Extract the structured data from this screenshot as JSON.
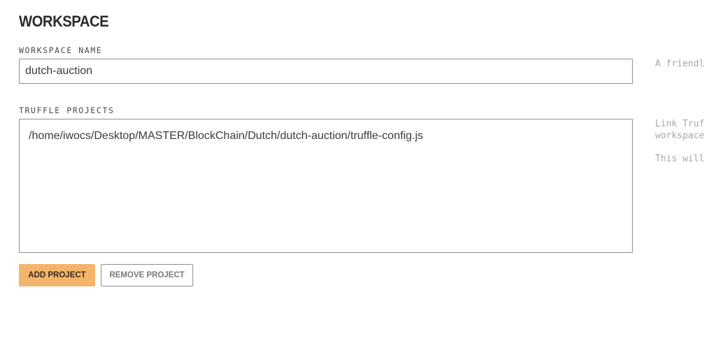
{
  "workspace": {
    "title": "WORKSPACE",
    "name_label": "WORKSPACE NAME",
    "name_value": "dutch-auction",
    "name_help": "A friendl",
    "projects_label": "TRUFFLE PROJECTS",
    "projects": [
      "/home/iwocs/Desktop/MASTER/BlockChain/Dutch/dutch-auction/truffle-config.js"
    ],
    "projects_help_line1": "Link Truf",
    "projects_help_line2": "workspace",
    "projects_help_line3": "This will",
    "add_project_label": "ADD PROJECT",
    "remove_project_label": "REMOVE PROJECT"
  },
  "colors": {
    "accent": "#f3b46b",
    "border": "#8f8f8f",
    "help_text": "#a8a8a8"
  }
}
